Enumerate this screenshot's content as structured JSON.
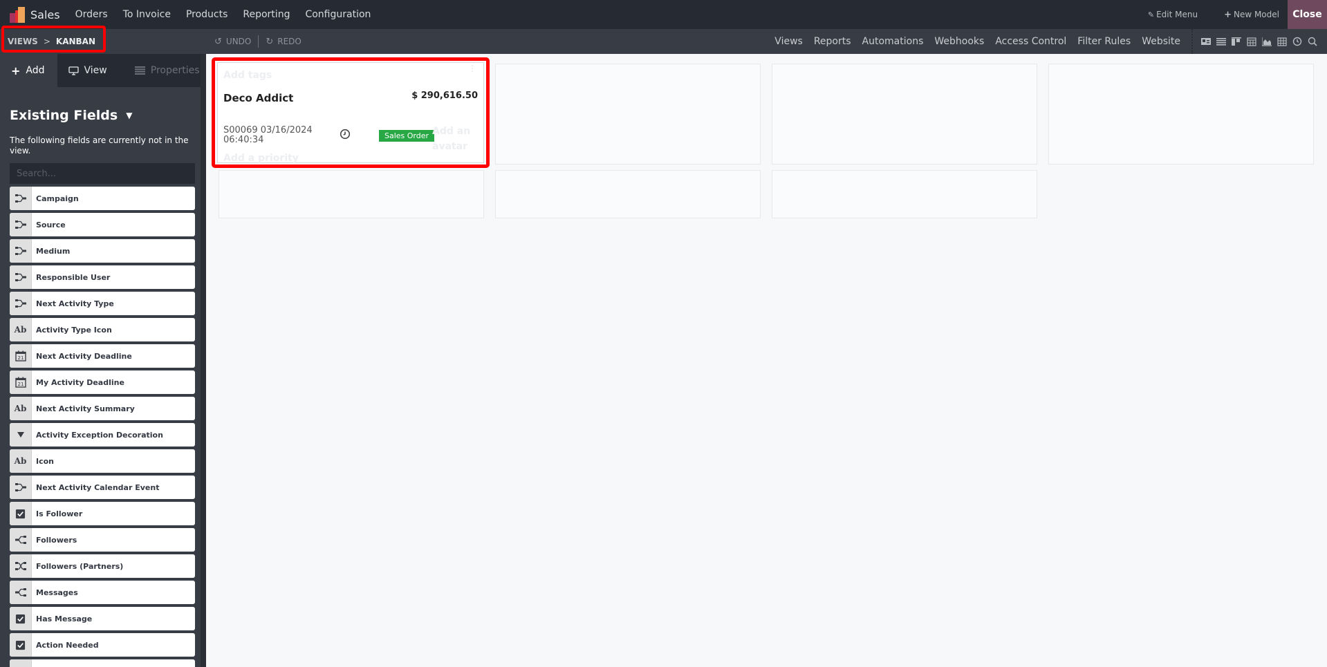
{
  "app": {
    "brand": "Sales",
    "menu": [
      "Orders",
      "To Invoice",
      "Products",
      "Reporting",
      "Configuration"
    ],
    "top_right": {
      "edit_menu": "Edit Menu",
      "new_model": "New Model",
      "close": "Close"
    }
  },
  "subbar": {
    "breadcrumb": [
      "VIEWS",
      "KANBAN"
    ],
    "breadcrumb_sep": ">",
    "undo": "UNDO",
    "redo": "REDO",
    "links": [
      "Views",
      "Reports",
      "Automations",
      "Webhooks",
      "Access Control",
      "Filter Rules",
      "Website"
    ],
    "view_switcher": [
      "form-view-icon",
      "list-view-icon",
      "kanban-view-icon",
      "calendar-view-icon",
      "graph-view-icon",
      "pivot-view-icon",
      "activity-view-icon",
      "search-view-icon"
    ]
  },
  "sidebar": {
    "tabs": [
      {
        "label": "Add",
        "icon": "plus-icon",
        "active": true
      },
      {
        "label": "View",
        "icon": "monitor-icon",
        "active": false
      },
      {
        "label": "Properties",
        "icon": "properties-icon",
        "active": false,
        "disabled": true
      }
    ],
    "section_title": "Existing Fields",
    "description": "The following fields are currently not in the view.",
    "search_placeholder": "Search...",
    "fields": [
      {
        "label": "Campaign",
        "type": "many2one"
      },
      {
        "label": "Source",
        "type": "many2one"
      },
      {
        "label": "Medium",
        "type": "many2one"
      },
      {
        "label": "Responsible User",
        "type": "many2one"
      },
      {
        "label": "Next Activity Type",
        "type": "many2one"
      },
      {
        "label": "Activity Type Icon",
        "type": "char"
      },
      {
        "label": "Next Activity Deadline",
        "type": "date"
      },
      {
        "label": "My Activity Deadline",
        "type": "date"
      },
      {
        "label": "Next Activity Summary",
        "type": "char"
      },
      {
        "label": "Activity Exception Decoration",
        "type": "selection"
      },
      {
        "label": "Icon",
        "type": "char"
      },
      {
        "label": "Next Activity Calendar Event",
        "type": "many2one"
      },
      {
        "label": "Is Follower",
        "type": "boolean"
      },
      {
        "label": "Followers",
        "type": "one2many"
      },
      {
        "label": "Followers (Partners)",
        "type": "many2many"
      },
      {
        "label": "Messages",
        "type": "one2many"
      },
      {
        "label": "Has Message",
        "type": "boolean"
      },
      {
        "label": "Action Needed",
        "type": "boolean"
      }
    ]
  },
  "kanban": {
    "card": {
      "tags_placeholder": "Add tags",
      "title": "Deco Addict",
      "amount": "$ 290,616.50",
      "reference": "S00069 03/16/2024 06:40:34",
      "badge": "Sales Order",
      "avatar_placeholder": "Add an avatar",
      "priority_placeholder": "Add a priority"
    },
    "colors": {
      "badge": "#28a745",
      "highlight": "#ff0000",
      "close_button": "#6f4a5f"
    }
  }
}
